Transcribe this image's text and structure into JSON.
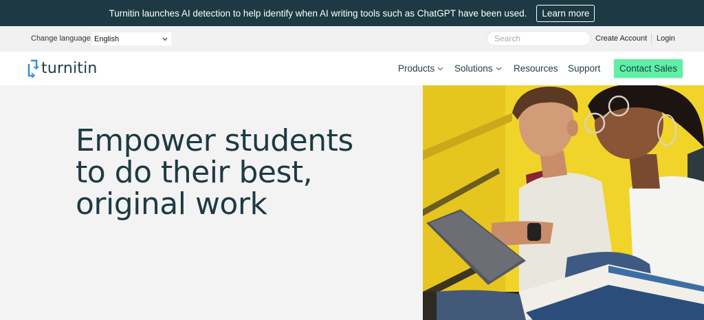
{
  "announcement": {
    "text": "Turnitin launches AI detection to help identify when AI writing tools such as ChatGPT have been used.",
    "button": "Learn more"
  },
  "utility": {
    "language_label": "Change language",
    "language_value": "English",
    "search_placeholder": "Search",
    "create_account": "Create Account",
    "login": "Login"
  },
  "nav": {
    "logo_text": "turnitin",
    "products": "Products",
    "solutions": "Solutions",
    "resources": "Resources",
    "support": "Support",
    "contact_sales": "Contact Sales"
  },
  "hero": {
    "title_line1": "Empower students",
    "title_line2": "to do their best,",
    "title_line3": "original work",
    "image_alt": "two students looking at a tablet"
  },
  "colors": {
    "announce_bg": "#1d3a44",
    "cta_green": "#5ef0a4",
    "text_dark": "#1e3a43",
    "photo_yellow": "#f2d52b"
  }
}
